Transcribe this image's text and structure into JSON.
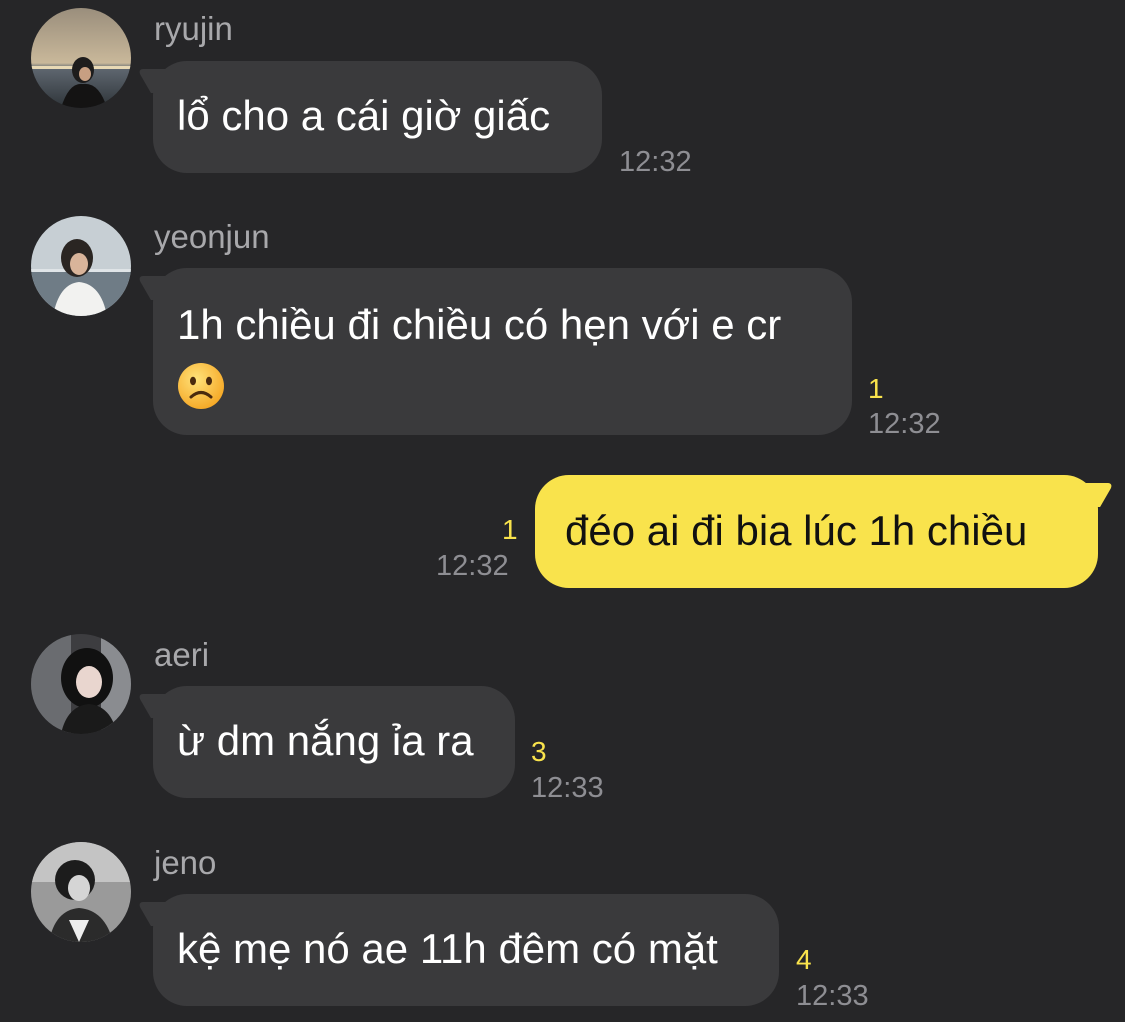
{
  "messages": [
    {
      "sender": "ryujin",
      "text": "lổ cho a cái giờ giấc",
      "time": "12:32",
      "unread": "",
      "avatar_icon": "ryujin-avatar"
    },
    {
      "sender": "yeonjun",
      "text": "1h chiều đi chiều có hẹn với e cr",
      "emoji": "frowning-face-icon",
      "time": "12:32",
      "unread": "1",
      "avatar_icon": "yeonjun-avatar"
    },
    {
      "sender": "",
      "text": "đéo ai đi bia lúc 1h chiều",
      "time": "12:32",
      "unread": "1",
      "mine": true
    },
    {
      "sender": "aeri",
      "text": "ừ dm nắng ỉa ra",
      "time": "12:33",
      "unread": "3",
      "avatar_icon": "aeri-avatar"
    },
    {
      "sender": "jeno",
      "text": "kệ mẹ nó ae 11h đêm có mặt",
      "time": "12:33",
      "unread": "4",
      "avatar_icon": "jeno-avatar"
    }
  ],
  "colors": {
    "background": "#262628",
    "bubble_other": "#3a3a3c",
    "bubble_mine": "#f9e34c",
    "unread_count": "#f9e34c",
    "timestamp": "#8e8e93",
    "sender_name": "#a8a8ab"
  }
}
